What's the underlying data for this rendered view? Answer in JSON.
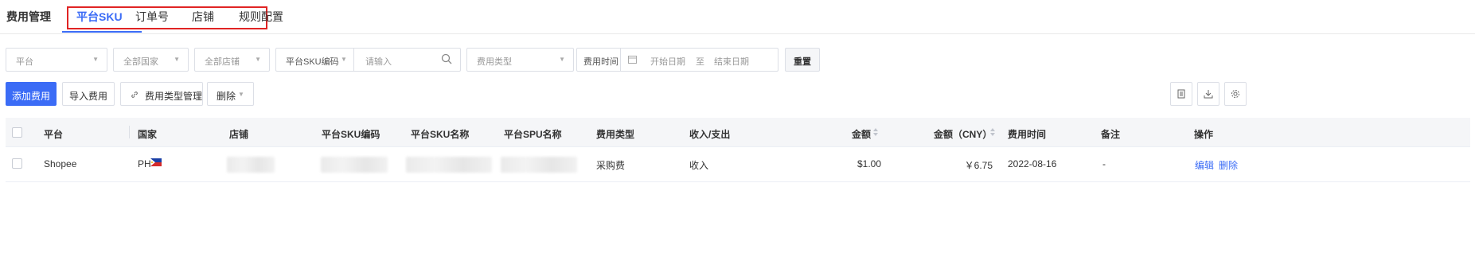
{
  "topnav": {
    "module_title": "费用管理",
    "tabs": [
      {
        "label": "平台SKU",
        "active": true
      },
      {
        "label": "订单号",
        "active": false
      },
      {
        "label": "店铺",
        "active": false
      },
      {
        "label": "规则配置",
        "active": false
      }
    ],
    "highlight_color": "#e02424"
  },
  "filters": {
    "platform": "平台",
    "country": "全部国家",
    "store": "全部店铺",
    "sku_type": "平台SKU编码",
    "search_placeholder": "请输入",
    "fee_type": "费用类型",
    "fee_time_label": "费用时间",
    "start_date": "开始日期",
    "to": "至",
    "end_date": "结束日期",
    "reset": "重置"
  },
  "toolbar": {
    "add": "添加费用",
    "import": "导入费用",
    "fee_type_manage": "费用类型管理",
    "delete": "删除"
  },
  "table": {
    "headers": [
      "平台",
      "国家",
      "店铺",
      "平台SKU编码",
      "平台SKU名称",
      "平台SPU名称",
      "费用类型",
      "收入/支出",
      "金额",
      "金额（CNY）",
      "费用时间",
      "备注",
      "操作"
    ],
    "rows": [
      {
        "platform": "Shopee",
        "country": "PH",
        "fee_type": "采购费",
        "income_expense": "收入",
        "amount": "$1.00",
        "amount_cny": "￥6.75",
        "fee_time": "2022-08-16",
        "remark": "-",
        "edit": "编辑",
        "delete": "删除"
      }
    ]
  },
  "colors": {
    "primary": "#3b6cf6",
    "header_bg": "#f5f6f8",
    "border": "#dcdfe6"
  },
  "icons": [
    "search-icon",
    "calendar-icon",
    "link-icon",
    "chevron-down-icon",
    "document-icon",
    "download-icon",
    "settings-icon",
    "sort-icon",
    "ph-flag-icon"
  ]
}
